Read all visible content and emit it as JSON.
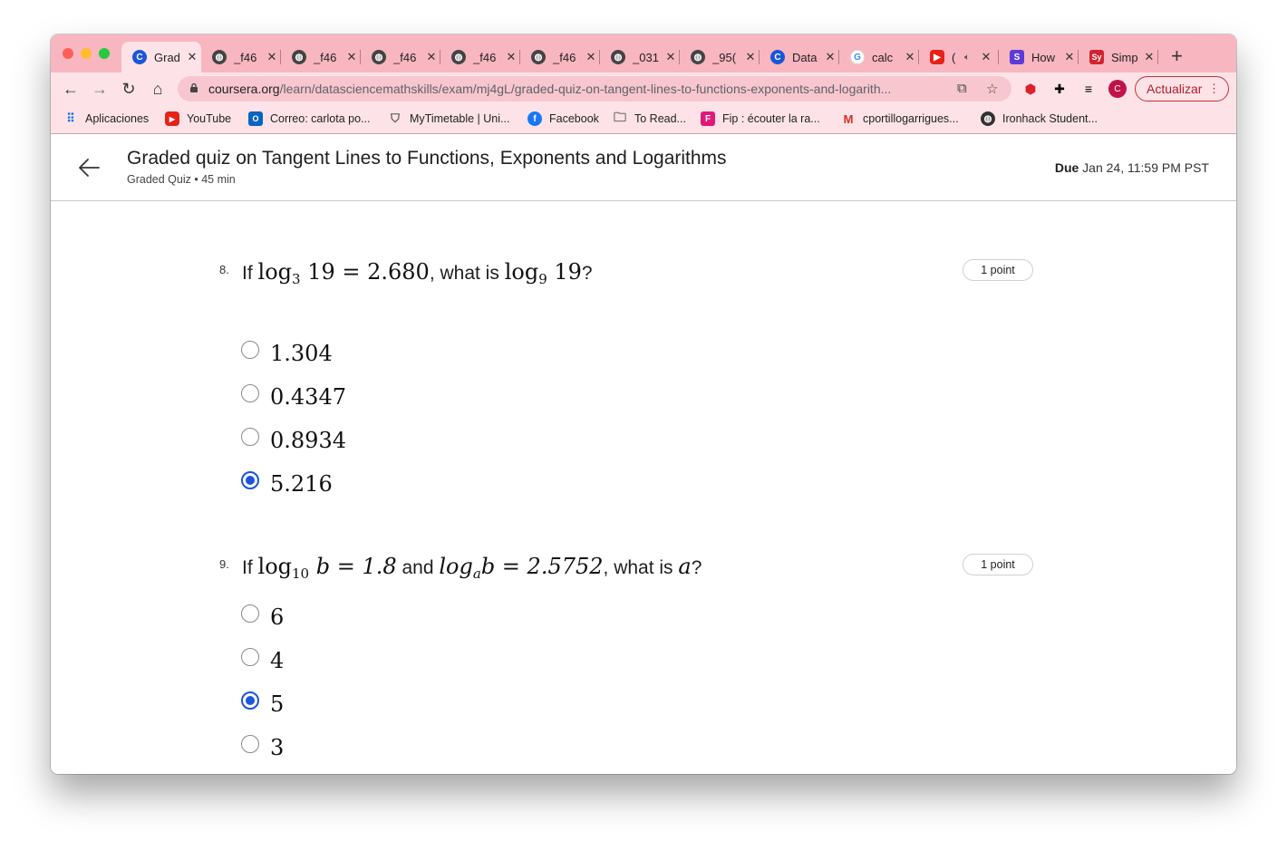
{
  "browser": {
    "tabs": [
      {
        "title": "Grad",
        "favicon": "coursera-icon",
        "active": true
      },
      {
        "title": "_f46",
        "favicon": "globe-icon"
      },
      {
        "title": "_f46",
        "favicon": "globe-icon"
      },
      {
        "title": "_f46",
        "favicon": "globe-icon"
      },
      {
        "title": "_f46",
        "favicon": "globe-icon"
      },
      {
        "title": "_f46",
        "favicon": "globe-icon"
      },
      {
        "title": "_031",
        "favicon": "globe-icon"
      },
      {
        "title": "_95(",
        "favicon": "globe-icon"
      },
      {
        "title": "Data",
        "favicon": "coursera-icon"
      },
      {
        "title": "calc",
        "favicon": "google-icon"
      },
      {
        "title": "(",
        "favicon": "youtube-icon"
      },
      {
        "title": "How",
        "favicon": "s-icon"
      },
      {
        "title": "Simp",
        "favicon": "sy-icon"
      }
    ],
    "url_host": "coursera.org",
    "url_path": "/learn/datasciencemathskills/exam/mj4gL/graded-quiz-on-tangent-lines-to-functions-exponents-and-logarith...",
    "update_label": "Actualizar",
    "profile_initial": "C",
    "bookmarks": [
      "Aplicaciones",
      "YouTube",
      "Correo: carlota po...",
      "MyTimetable | Uni...",
      "Facebook",
      "To Read...",
      "Fip : écouter la ra...",
      "cportillogarrigues...",
      "Ironhack Student..."
    ]
  },
  "quiz": {
    "title": "Graded quiz on Tangent Lines to Functions, Exponents and Logarithms",
    "subtitle": "Graded Quiz • 45 min",
    "due_label": "Due",
    "due_value": "Jan 24, 11:59 PM PST"
  },
  "questions": [
    {
      "number": "8.",
      "prefix": "If",
      "math1_base": "log",
      "math1_sub": "3",
      "math1_rest": " 19 = 2.680",
      "middle": ", what is ",
      "math2_base": "log",
      "math2_sub": "9",
      "math2_rest": " 19",
      "suffix": "?",
      "points": "1 point",
      "options": [
        "1.304",
        "0.4347",
        "0.8934",
        "5.216"
      ],
      "selected_index": 3
    },
    {
      "number": "9.",
      "prefix": "If",
      "math1_base": "log",
      "math1_sub": "10",
      "math1_rest": " b = 1.8",
      "middle": " and ",
      "math2_base": "log",
      "math2_sub": "a",
      "math2_rest": "b = 2.5752",
      "middle2": ", what is ",
      "math3": "a",
      "suffix": "?",
      "points": "1 point",
      "options": [
        "6",
        "4",
        "5",
        "3"
      ],
      "selected_index": 2
    }
  ],
  "colors": {
    "tabstrip": "#f8b6c0",
    "toolbar": "#fde3e7",
    "accent_blue": "#1a56d9"
  }
}
